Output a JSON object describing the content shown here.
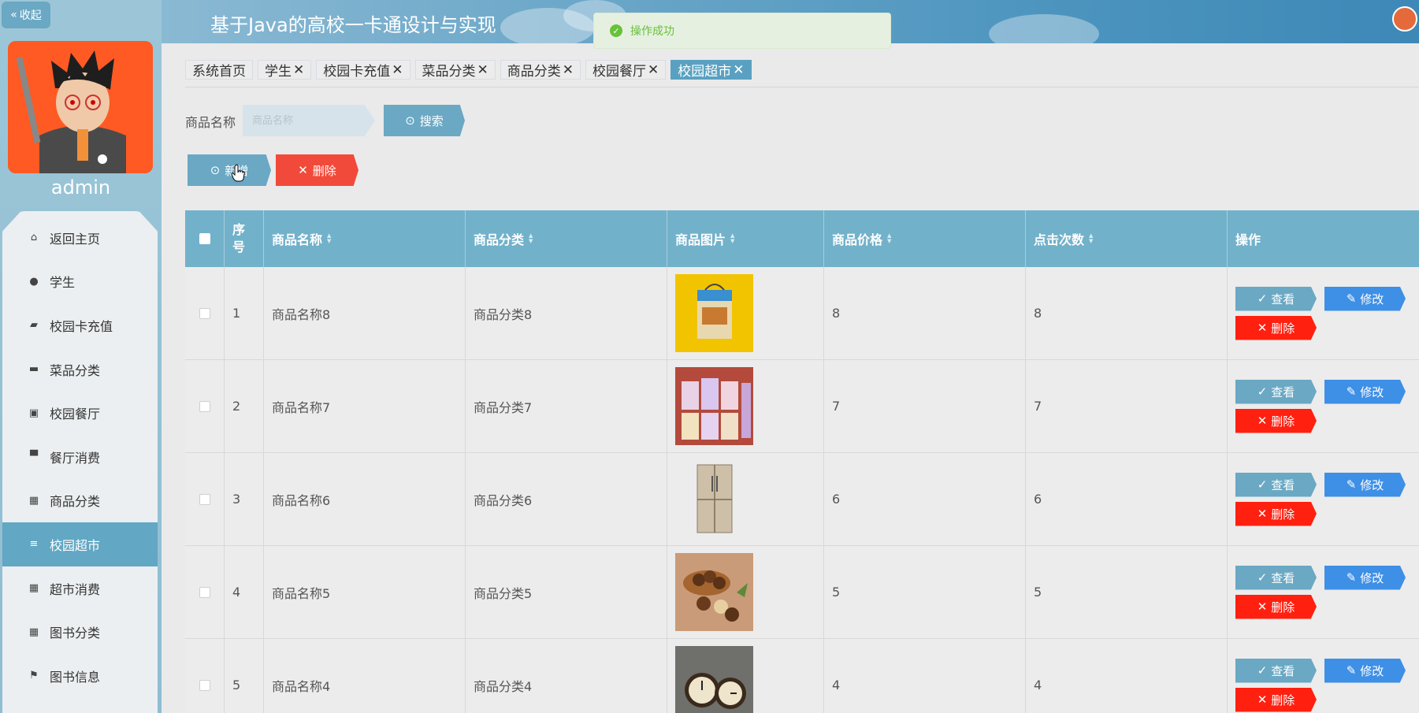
{
  "sidebar": {
    "collapse_label": "收起",
    "username": "admin",
    "items": [
      {
        "label": "返回主页",
        "icon": "home-icon",
        "glyph": "⌂"
      },
      {
        "label": "学生",
        "icon": "user-icon",
        "glyph": "●"
      },
      {
        "label": "校园卡充值",
        "icon": "card-icon",
        "glyph": "▰"
      },
      {
        "label": "菜品分类",
        "icon": "chat-icon",
        "glyph": "▬"
      },
      {
        "label": "校园餐厅",
        "icon": "clipboard-icon",
        "glyph": "▣"
      },
      {
        "label": "餐厅消费",
        "icon": "monitor-icon",
        "glyph": "▀"
      },
      {
        "label": "商品分类",
        "icon": "grid-icon",
        "glyph": "▦"
      },
      {
        "label": "校园超市",
        "icon": "menu-icon",
        "glyph": "≡"
      },
      {
        "label": "超市消费",
        "icon": "grid-icon",
        "glyph": "▦"
      },
      {
        "label": "图书分类",
        "icon": "grid-icon",
        "glyph": "▦"
      },
      {
        "label": "图书信息",
        "icon": "flag-icon",
        "glyph": "⚑"
      }
    ],
    "active_index": 7
  },
  "header": {
    "title": "基于Java的高校一卡通设计与实现"
  },
  "toast": {
    "message": "操作成功"
  },
  "tabs": [
    {
      "label": "系统首页",
      "closable": false
    },
    {
      "label": "学生",
      "closable": true
    },
    {
      "label": "校园卡充值",
      "closable": true
    },
    {
      "label": "菜品分类",
      "closable": true
    },
    {
      "label": "商品分类",
      "closable": true
    },
    {
      "label": "校园餐厅",
      "closable": true
    },
    {
      "label": "校园超市",
      "closable": true,
      "active": true
    }
  ],
  "search": {
    "label": "商品名称",
    "placeholder": "商品名称",
    "button_label": "搜索"
  },
  "actions": {
    "add_label": "新增",
    "delete_label": "删除"
  },
  "table": {
    "headers": {
      "index": "序号",
      "name": "商品名称",
      "category": "商品分类",
      "image": "商品图片",
      "price": "商品价格",
      "clicks": "点击次数",
      "ops": "操作"
    },
    "op_labels": {
      "view": "查看",
      "edit": "修改",
      "delete": "删除"
    },
    "rows": [
      {
        "index": "1",
        "name": "商品名称8",
        "category": "商品分类8",
        "image": "snack-box",
        "price": "8",
        "clicks": "8"
      },
      {
        "index": "2",
        "name": "商品名称7",
        "category": "商品分类7",
        "image": "shelf-boxes",
        "price": "7",
        "clicks": "7"
      },
      {
        "index": "3",
        "name": "商品名称6",
        "category": "商品分类6",
        "image": "refrigerator",
        "price": "6",
        "clicks": "6"
      },
      {
        "index": "4",
        "name": "商品名称5",
        "category": "商品分类5",
        "image": "nuts",
        "price": "5",
        "clicks": "5"
      },
      {
        "index": "5",
        "name": "商品名称4",
        "category": "商品分类4",
        "image": "clocks",
        "price": "4",
        "clicks": "4"
      }
    ]
  }
}
